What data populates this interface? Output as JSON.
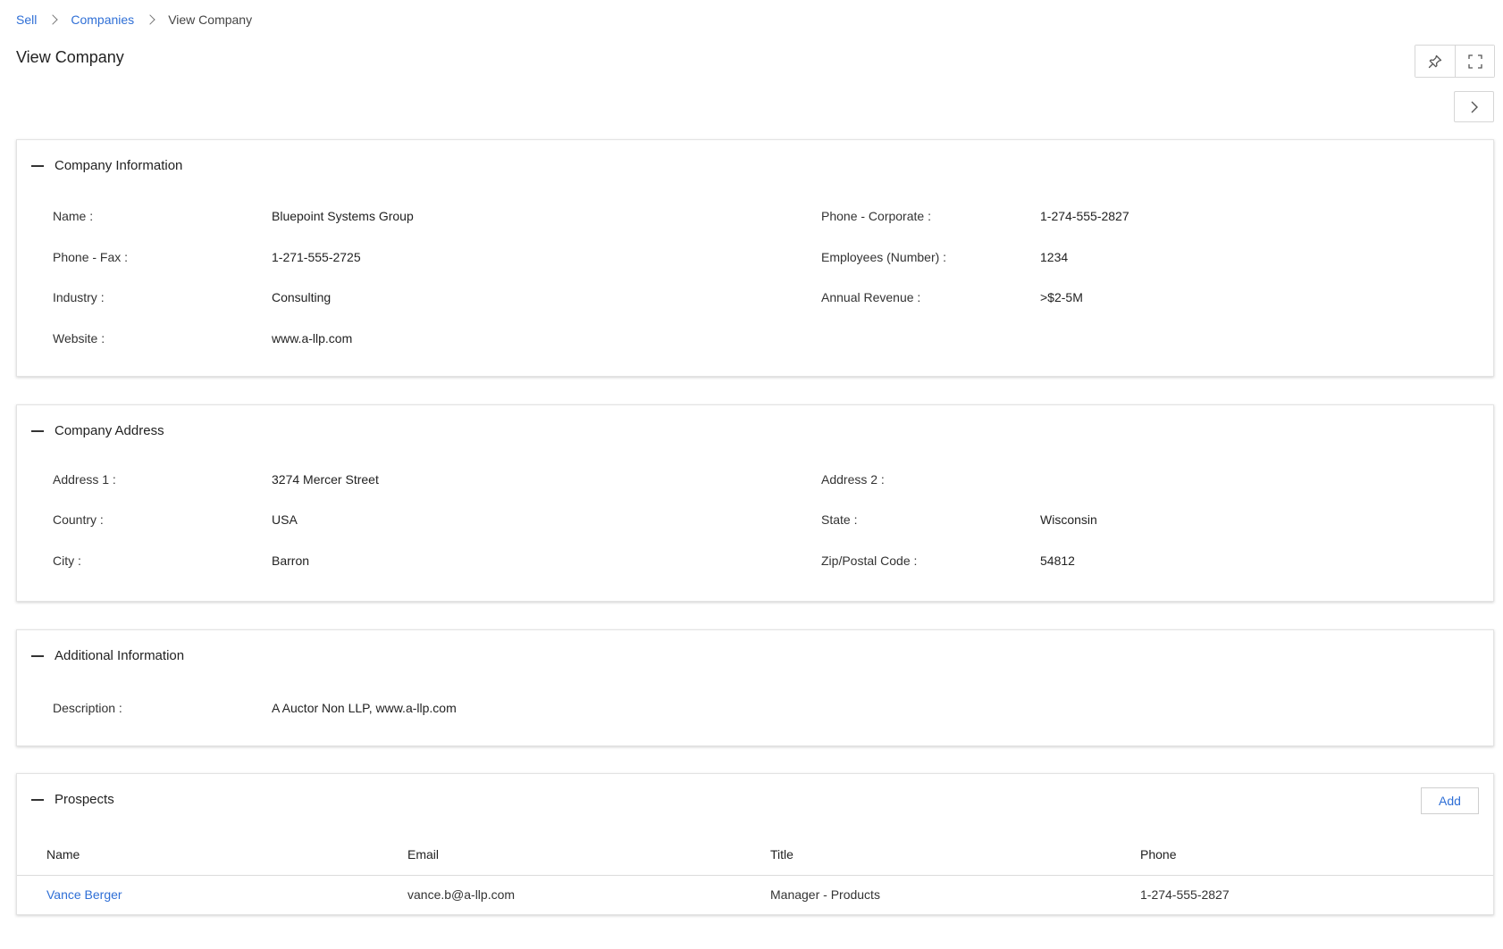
{
  "breadcrumb": {
    "items": [
      {
        "label": "Sell"
      },
      {
        "label": "Companies"
      }
    ],
    "current": "View Company"
  },
  "page_title": "View Company",
  "icons": {
    "pin": "pin-icon",
    "expand": "expand-icon",
    "next": "chevron-right-icon",
    "collapse": "minus-icon"
  },
  "company_info": {
    "title": "Company Information",
    "name_label": "Name :",
    "name_value": "Bluepoint Systems Group",
    "phone_corporate_label": "Phone - Corporate :",
    "phone_corporate_value": "1-274-555-2827",
    "phone_fax_label": "Phone - Fax :",
    "phone_fax_value": "1-271-555-2725",
    "employees_label": "Employees (Number) :",
    "employees_value": "1234",
    "industry_label": "Industry :",
    "industry_value": "Consulting",
    "annual_revenue_label": "Annual Revenue :",
    "annual_revenue_value": ">$2-5M",
    "website_label": "Website :",
    "website_value": "www.a-llp.com"
  },
  "company_address": {
    "title": "Company Address",
    "address1_label": "Address 1 :",
    "address1_value": "3274 Mercer Street",
    "address2_label": "Address 2 :",
    "address2_value": "",
    "country_label": "Country :",
    "country_value": "USA",
    "state_label": "State :",
    "state_value": "Wisconsin",
    "city_label": "City :",
    "city_value": "Barron",
    "zip_label": "Zip/Postal Code :",
    "zip_value": "54812"
  },
  "additional_info": {
    "title": "Additional Information",
    "description_label": "Description :",
    "description_value": "A Auctor Non LLP, www.a-llp.com"
  },
  "prospects": {
    "title": "Prospects",
    "add_label": "Add",
    "columns": [
      "Name",
      "Email",
      "Title",
      "Phone"
    ],
    "rows": [
      {
        "name": "Vance Berger",
        "email": "vance.b@a-llp.com",
        "title": "Manager - Products",
        "phone": "1-274-555-2827"
      }
    ]
  },
  "colors": {
    "accent": "#2f6fd6",
    "border": "#e3e3e3",
    "text": "#222222"
  }
}
